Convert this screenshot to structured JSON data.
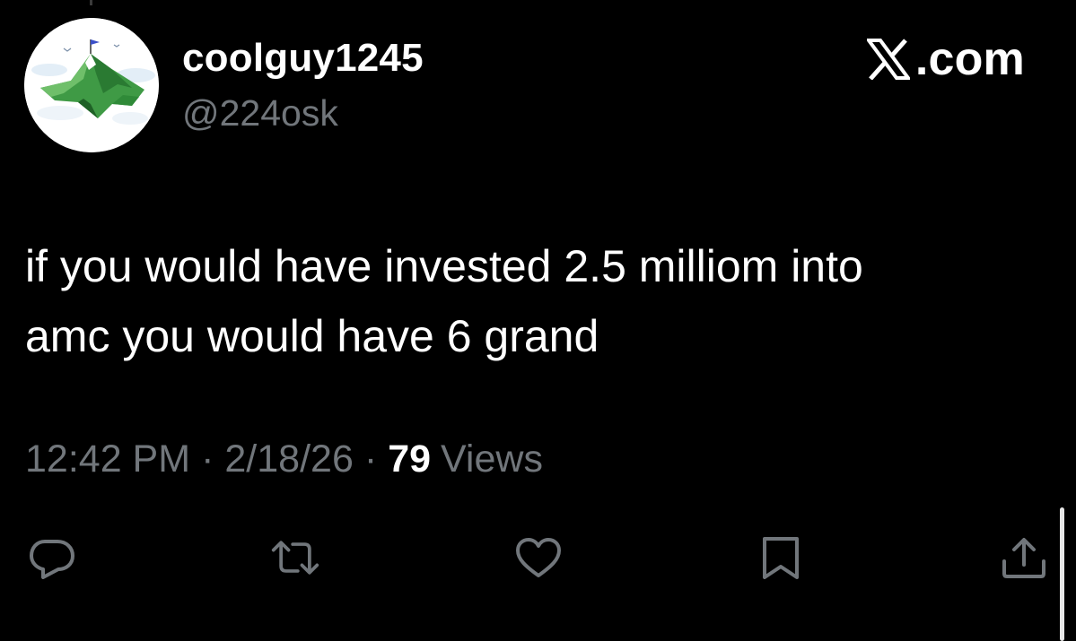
{
  "author": {
    "display_name": "coolguy1245",
    "handle": "@224osk",
    "avatar": "mountain-peak-with-flag"
  },
  "brand": {
    "logo_icon": "x-logo-icon",
    "suffix": ".com"
  },
  "tweet": {
    "text_line_1": "if you would have invested 2.5 milliom into",
    "text_line_2": "amc you would have 6 grand"
  },
  "meta": {
    "time": "12:42 PM",
    "separator": "·",
    "date": "2/18/26",
    "views_count": "79",
    "views_label": "Views"
  },
  "actions": [
    {
      "name": "reply",
      "icon": "reply-icon"
    },
    {
      "name": "repost",
      "icon": "repost-icon"
    },
    {
      "name": "like",
      "icon": "heart-icon"
    },
    {
      "name": "bookmark",
      "icon": "bookmark-icon"
    },
    {
      "name": "share",
      "icon": "share-icon"
    }
  ],
  "colors": {
    "background": "#000000",
    "text_primary": "#ffffff",
    "text_secondary": "#71767b",
    "icon": "#71767b"
  }
}
